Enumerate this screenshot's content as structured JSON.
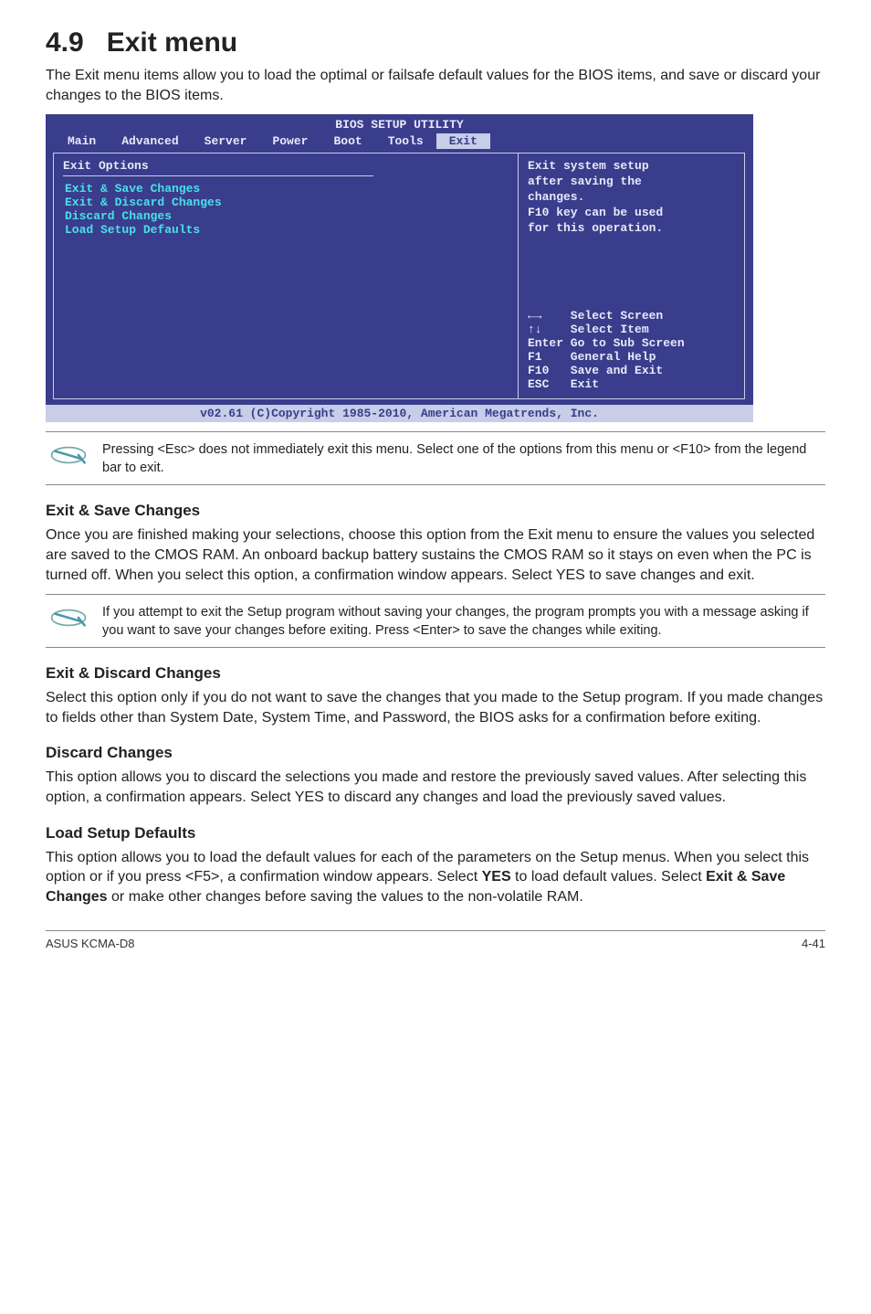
{
  "section": {
    "number": "4.9",
    "title": "Exit menu",
    "intro": "The Exit menu items allow you to load the optimal or failsafe default values for the BIOS items, and save or discard your changes to the BIOS items."
  },
  "bios": {
    "header": "BIOS SETUP UTILITY",
    "tabs": [
      "Main",
      "Advanced",
      "Server",
      "Power",
      "Boot",
      "Tools",
      "Exit"
    ],
    "active_tab": "Exit",
    "left_title": "Exit Options",
    "left_items": [
      "Exit & Save Changes",
      "Exit & Discard Changes",
      "Discard Changes",
      "",
      "Load Setup Defaults"
    ],
    "right_help_top": [
      "Exit system setup",
      "after saving the",
      "changes.",
      "",
      "F10 key can be used",
      "for this operation."
    ],
    "right_help_bottom": [
      "←→    Select Screen",
      "↑↓    Select Item",
      "Enter Go to Sub Screen",
      "F1    General Help",
      "F10   Save and Exit",
      "ESC   Exit"
    ],
    "footer": "v02.61 (C)Copyright 1985-2010, American Megatrends, Inc."
  },
  "note1": "Pressing <Esc> does not immediately exit this menu. Select one of the options from this menu or <F10> from the legend bar to exit.",
  "sec1": {
    "title": "Exit & Save Changes",
    "body": "Once you are finished making your selections, choose this option from the Exit menu to ensure the values you selected are saved to the CMOS RAM. An onboard backup battery sustains the CMOS RAM so it stays on even when the PC is turned off. When you select this option, a confirmation window appears. Select YES to save changes and exit."
  },
  "note2": "If you attempt to exit the Setup program without saving your changes, the program prompts you with a message asking if you want to save your changes before exiting. Press <Enter> to save the changes while exiting.",
  "sec2": {
    "title": "Exit & Discard Changes",
    "body": "Select this option only if you do not want to save the changes that you made to the Setup program. If you made changes to fields other than System Date, System Time, and Password, the BIOS asks for a confirmation before exiting."
  },
  "sec3": {
    "title": "Discard Changes",
    "body": "This option allows you to discard the selections you made and restore the previously saved values. After selecting this option, a confirmation appears. Select YES to discard any changes and load the previously saved values."
  },
  "sec4": {
    "title": "Load Setup Defaults",
    "body_pre": "This option allows you to load the default values for each of the parameters on the Setup menus. When you select this option or if you press <F5>, a confirmation window appears. Select ",
    "bold1": "YES",
    "body_mid": " to load default values. Select ",
    "bold2": "Exit & Save Changes",
    "body_post": " or make other changes before saving the values to the non-volatile RAM."
  },
  "footer": {
    "left": "ASUS KCMA-D8",
    "right": "4-41"
  }
}
